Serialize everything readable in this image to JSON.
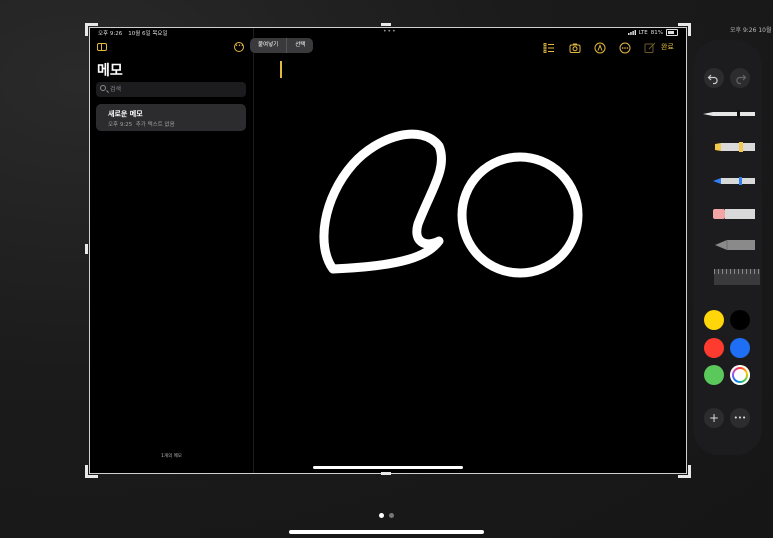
{
  "status_bar": {
    "time": "오후 9:26",
    "date": "10월 6일 목요일",
    "carrier": "LTE",
    "battery": "81%"
  },
  "background_status": {
    "time": "오후 9:26",
    "date": "10월"
  },
  "sidebar": {
    "title": "메모",
    "search_placeholder": "검색",
    "notes": [
      {
        "title": "새로운 메모",
        "time": "오후 9:25",
        "preview": "추가 텍스트 없음"
      }
    ],
    "count_label": "1개의 메모"
  },
  "edit_menu": {
    "paste": "붙여넣기",
    "select": "선택"
  },
  "toolbar": {
    "done_label": "완료"
  },
  "palette": {
    "undo_icon": "undo-icon",
    "redo_icon": "redo-icon",
    "tools": [
      "pen",
      "marker",
      "pencil",
      "eraser",
      "lasso",
      "ruler"
    ],
    "colors": [
      "#ffd60a",
      "#000000",
      "#ff3b30",
      "#1f6ff5",
      "#5ac85a",
      "multicolor"
    ],
    "selected_color": "multicolor",
    "add_icon": "plus-icon",
    "more_icon": "ellipsis-icon"
  },
  "accent_color": "#e4b93f"
}
